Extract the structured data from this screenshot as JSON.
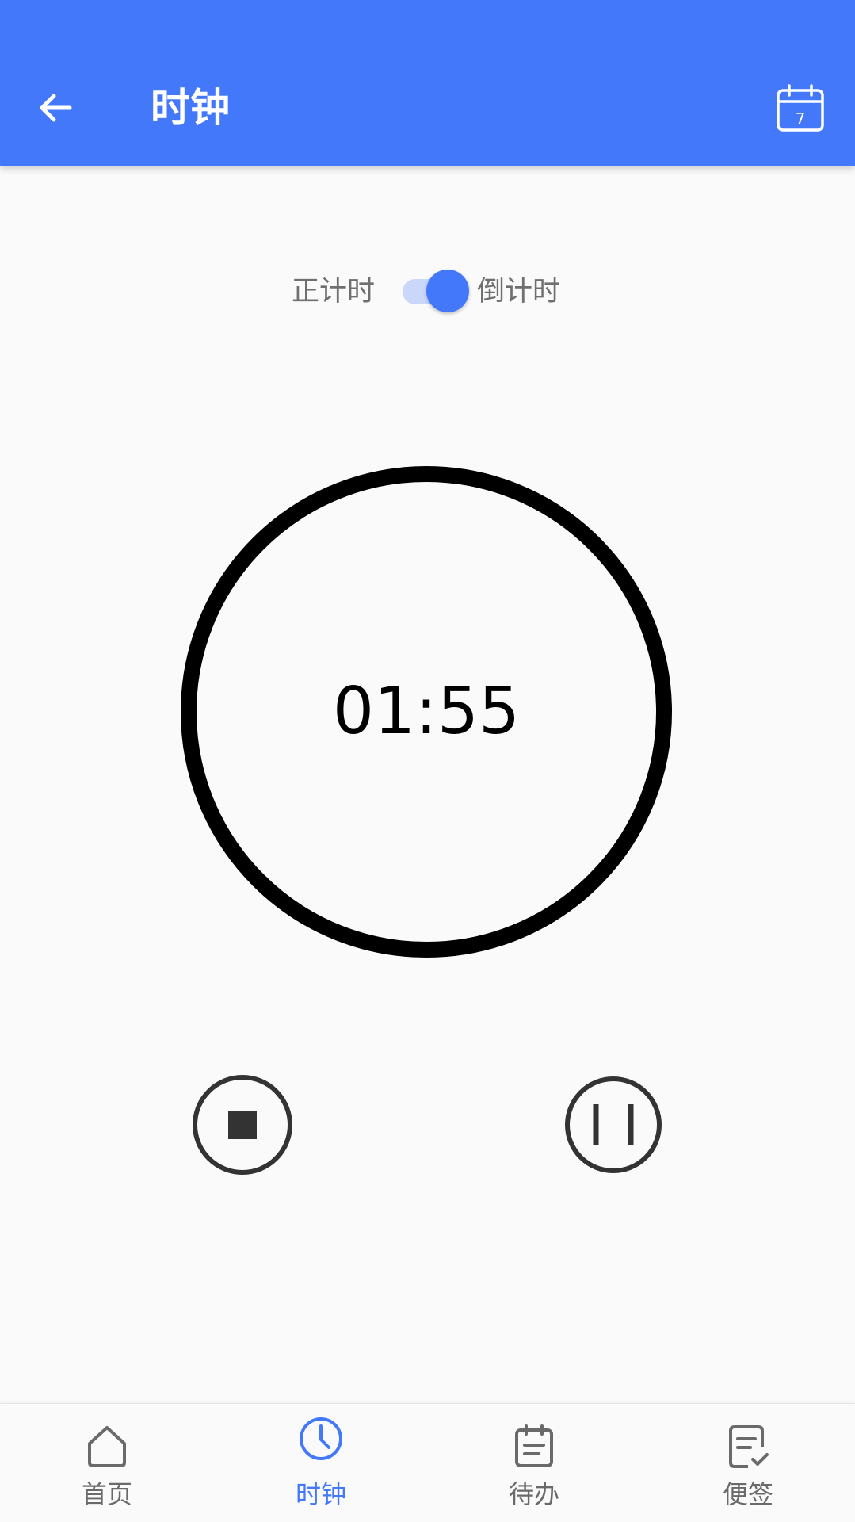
{
  "app_bar": {
    "title": "时钟",
    "back_icon": "arrow-left-icon",
    "calendar_icon": "calendar-icon",
    "calendar_day": "7",
    "background": "#4378fb"
  },
  "mode_toggle": {
    "left_label": "正计时",
    "right_label": "倒计时",
    "selected": "倒计时",
    "accent": "#4378fb"
  },
  "timer": {
    "display": "01:55"
  },
  "controls": {
    "stop_icon": "stop-icon",
    "pause_icon": "pause-icon"
  },
  "bottom_nav": {
    "active_color": "#4378fb",
    "items": [
      {
        "label": "首页",
        "icon": "home-icon"
      },
      {
        "label": "时钟",
        "icon": "clock-icon",
        "active": true
      },
      {
        "label": "待办",
        "icon": "todo-icon"
      },
      {
        "label": "便签",
        "icon": "note-icon"
      }
    ]
  }
}
